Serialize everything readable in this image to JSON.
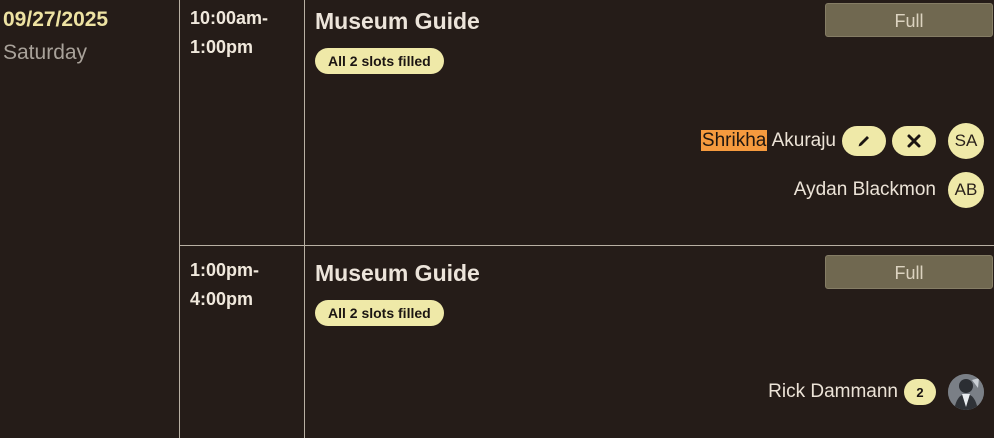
{
  "date": {
    "day": "09/27/2025",
    "weekday": "Saturday"
  },
  "slots": [
    {
      "time": [
        "10:00am-",
        "1:00pm"
      ],
      "title": "Museum Guide",
      "status_pill": "All 2 slots filled",
      "full_label": "Full",
      "people": [
        {
          "first": "Shrikha",
          "last": "Akuraju",
          "initials": "SA"
        },
        {
          "name": "Aydan Blackmon",
          "initials": "AB"
        }
      ]
    },
    {
      "time": [
        "1:00pm-",
        "4:00pm"
      ],
      "title": "Museum Guide",
      "status_pill": "All 2 slots filled",
      "full_label": "Full",
      "people": [
        {
          "name": "Rick Dammann",
          "count": "2"
        }
      ]
    }
  ],
  "icons": {
    "edit": "pencil-icon",
    "remove": "close-icon"
  },
  "colors": {
    "accent": "#efe9a8",
    "highlight": "#f59a3e",
    "full_button": "#706850"
  }
}
